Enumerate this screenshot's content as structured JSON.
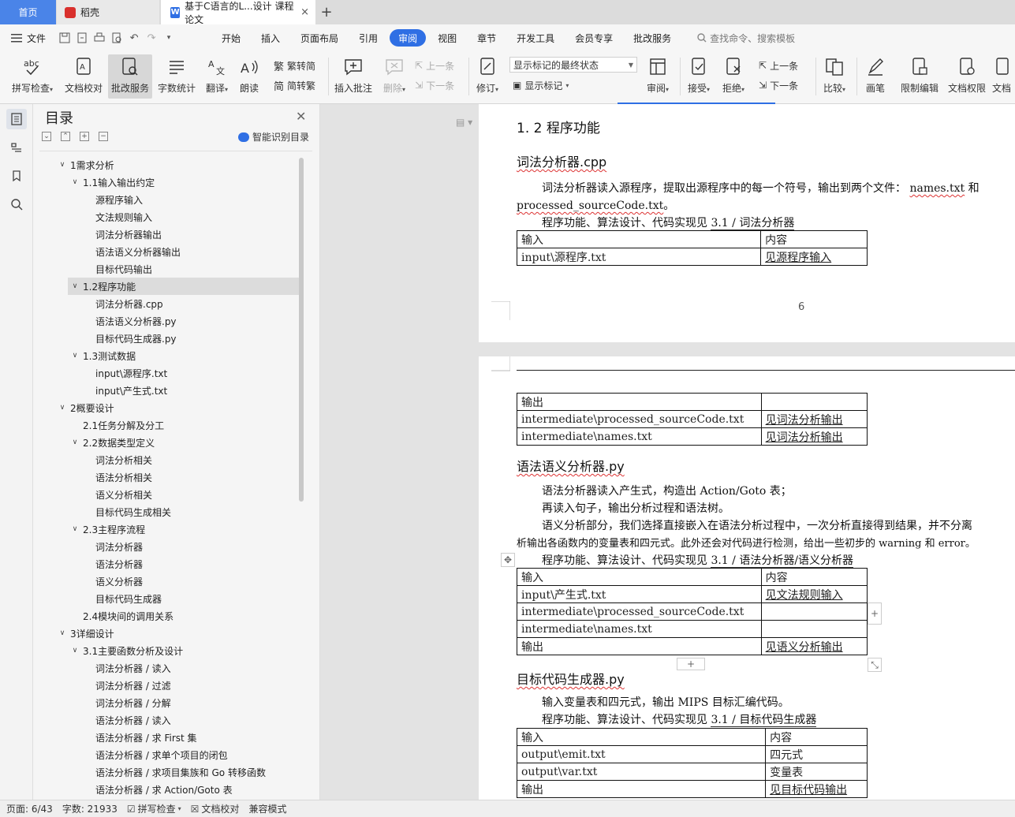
{
  "tabs": {
    "home": "首页",
    "daoke": "稻壳",
    "doc": "基于C语言的L...设计 课程论文",
    "close": "×",
    "plus": "+"
  },
  "menubar": {
    "file": "文件",
    "items": [
      "开始",
      "插入",
      "页面布局",
      "引用",
      "审阅",
      "视图",
      "章节",
      "开发工具",
      "会员专享",
      "批改服务"
    ],
    "active_index": 4,
    "search": "查找命令、搜索模板"
  },
  "toolbar": {
    "spell": "拼写检查",
    "proofread": "文档校对",
    "correct_service": "批改服务",
    "word_count": "字数统计",
    "translate": "翻译",
    "read_aloud": "朗读",
    "to_traditional": "繁转简",
    "to_simplified": "简转繁",
    "insert_comment": "插入批注",
    "delete": "删除",
    "prev": "上一条",
    "next": "下一条",
    "revise": "修订",
    "markup_select": "显示标记的最终状态",
    "show_markup": "显示标记",
    "review": "审阅",
    "accept": "接受",
    "reject": "拒绝",
    "prev2": "上一条",
    "next2": "下一条",
    "compare": "比较",
    "pen": "画笔",
    "restrict_edit": "限制编辑",
    "doc_rights": "文档权限",
    "doc_cut": "文档"
  },
  "toc": {
    "title": "目录",
    "smart": "智能识别目录",
    "items": [
      {
        "text": "1需求分析",
        "level": 1,
        "toggle": "open"
      },
      {
        "text": "1.1输入输出约定",
        "level": 2,
        "toggle": "open"
      },
      {
        "text": "源程序输入",
        "level": 3,
        "toggle": ""
      },
      {
        "text": "文法规则输入",
        "level": 3,
        "toggle": ""
      },
      {
        "text": "词法分析器输出",
        "level": 3,
        "toggle": ""
      },
      {
        "text": "语法语义分析器输出",
        "level": 3,
        "toggle": ""
      },
      {
        "text": "目标代码输出",
        "level": 3,
        "toggle": ""
      },
      {
        "text": "1.2程序功能",
        "level": 2,
        "toggle": "open",
        "selected": true
      },
      {
        "text": "词法分析器.cpp",
        "level": 3,
        "toggle": ""
      },
      {
        "text": "语法语义分析器.py",
        "level": 3,
        "toggle": ""
      },
      {
        "text": "目标代码生成器.py",
        "level": 3,
        "toggle": ""
      },
      {
        "text": "1.3测试数据",
        "level": 2,
        "toggle": "open"
      },
      {
        "text": "input\\源程序.txt",
        "level": 3,
        "toggle": ""
      },
      {
        "text": "input\\产生式.txt",
        "level": 3,
        "toggle": ""
      },
      {
        "text": "2概要设计",
        "level": 1,
        "toggle": "open"
      },
      {
        "text": "2.1任务分解及分工",
        "level": 2,
        "toggle": ""
      },
      {
        "text": "2.2数据类型定义",
        "level": 2,
        "toggle": "open"
      },
      {
        "text": "词法分析相关",
        "level": 3,
        "toggle": ""
      },
      {
        "text": "语法分析相关",
        "level": 3,
        "toggle": ""
      },
      {
        "text": "语义分析相关",
        "level": 3,
        "toggle": ""
      },
      {
        "text": "目标代码生成相关",
        "level": 3,
        "toggle": ""
      },
      {
        "text": "2.3主程序流程",
        "level": 2,
        "toggle": "open"
      },
      {
        "text": "词法分析器",
        "level": 3,
        "toggle": ""
      },
      {
        "text": "语法分析器",
        "level": 3,
        "toggle": ""
      },
      {
        "text": "语义分析器",
        "level": 3,
        "toggle": ""
      },
      {
        "text": "目标代码生成器",
        "level": 3,
        "toggle": ""
      },
      {
        "text": "2.4模块间的调用关系",
        "level": 2,
        "toggle": ""
      },
      {
        "text": "3详细设计",
        "level": 1,
        "toggle": "open"
      },
      {
        "text": "3.1主要函数分析及设计",
        "level": 2,
        "toggle": "open"
      },
      {
        "text": "词法分析器 / 读入",
        "level": 3,
        "toggle": ""
      },
      {
        "text": "词法分析器 / 过滤",
        "level": 3,
        "toggle": ""
      },
      {
        "text": "词法分析器 / 分解",
        "level": 3,
        "toggle": ""
      },
      {
        "text": "语法分析器 / 读入",
        "level": 3,
        "toggle": ""
      },
      {
        "text": "语法分析器 / 求 First 集",
        "level": 3,
        "toggle": ""
      },
      {
        "text": "语法分析器 / 求单个项目的闭包",
        "level": 3,
        "toggle": ""
      },
      {
        "text": "语法分析器 / 求项目集族和 Go 转移函数",
        "level": 3,
        "toggle": ""
      },
      {
        "text": "语法分析器 / 求 Action/Goto 表",
        "level": 3,
        "toggle": ""
      }
    ]
  },
  "doc": {
    "page1": {
      "heading": "1. 2 程序功能",
      "sub1": "词法分析器.cpp",
      "para1": "词法分析器读入源程序，提取出源程序中的每一个符号，输出到两个文件：",
      "para1_file": "names.txt",
      "para1_tail": "和",
      "para1_line2a": "processed_sourceCode.txt",
      "para1_line2b": "。",
      "ref_prefix": "程序功能、算法设计、代码实现见",
      "ref_link": "3.1 / 词法分析器",
      "table": [
        [
          "输入",
          "内容"
        ],
        [
          "input\\源程序.txt",
          "见源程序输入"
        ]
      ],
      "page_number": "6"
    },
    "page2": {
      "table1": [
        [
          "输出",
          ""
        ],
        [
          "intermediate\\processed_sourceCode.txt",
          "见词法分析输出"
        ],
        [
          "intermediate\\names.txt",
          "见词法分析输出"
        ]
      ],
      "sub2": "语法语义分析器.py",
      "p1": "语法分析器读入产生式，构造出 Action/Goto 表；",
      "p2": "再读入句子，输出分析过程和语法树。",
      "p3": "语义分析部分，我们选择直接嵌入在语法分析过程中，一次分析直接得到结果，并不分离",
      "p4": "析输出各函数内的变量表和四元式。此外还会对代码进行检测，给出一些初步的 warning 和 error。",
      "ref_prefix": "程序功能、算法设计、代码实现见",
      "ref_link2": "3.1 / 语法分析器/语义分析器",
      "table2": [
        [
          "输入",
          "内容"
        ],
        [
          "input\\产生式.txt",
          "见文法规则输入"
        ],
        [
          "intermediate\\processed_sourceCode.txt",
          ""
        ],
        [
          "intermediate\\names.txt",
          ""
        ],
        [
          "输出",
          "见语义分析输出"
        ]
      ],
      "sub3": "目标代码生成器.py",
      "p5": "输入变量表和四元式，输出 MIPS 目标汇编代码。",
      "ref_link3": "3.1 / 目标代码生成器",
      "table3": [
        [
          "输入",
          "内容"
        ],
        [
          "output\\emit.txt",
          "四元式"
        ],
        [
          "output\\var.txt",
          "变量表"
        ],
        [
          "输出",
          "见目标代码输出"
        ]
      ]
    }
  },
  "status": {
    "page": "页面: 6/43",
    "words": "字数: 21933",
    "spell": "拼写检查",
    "proofread": "文档校对",
    "compat": "兼容模式"
  }
}
